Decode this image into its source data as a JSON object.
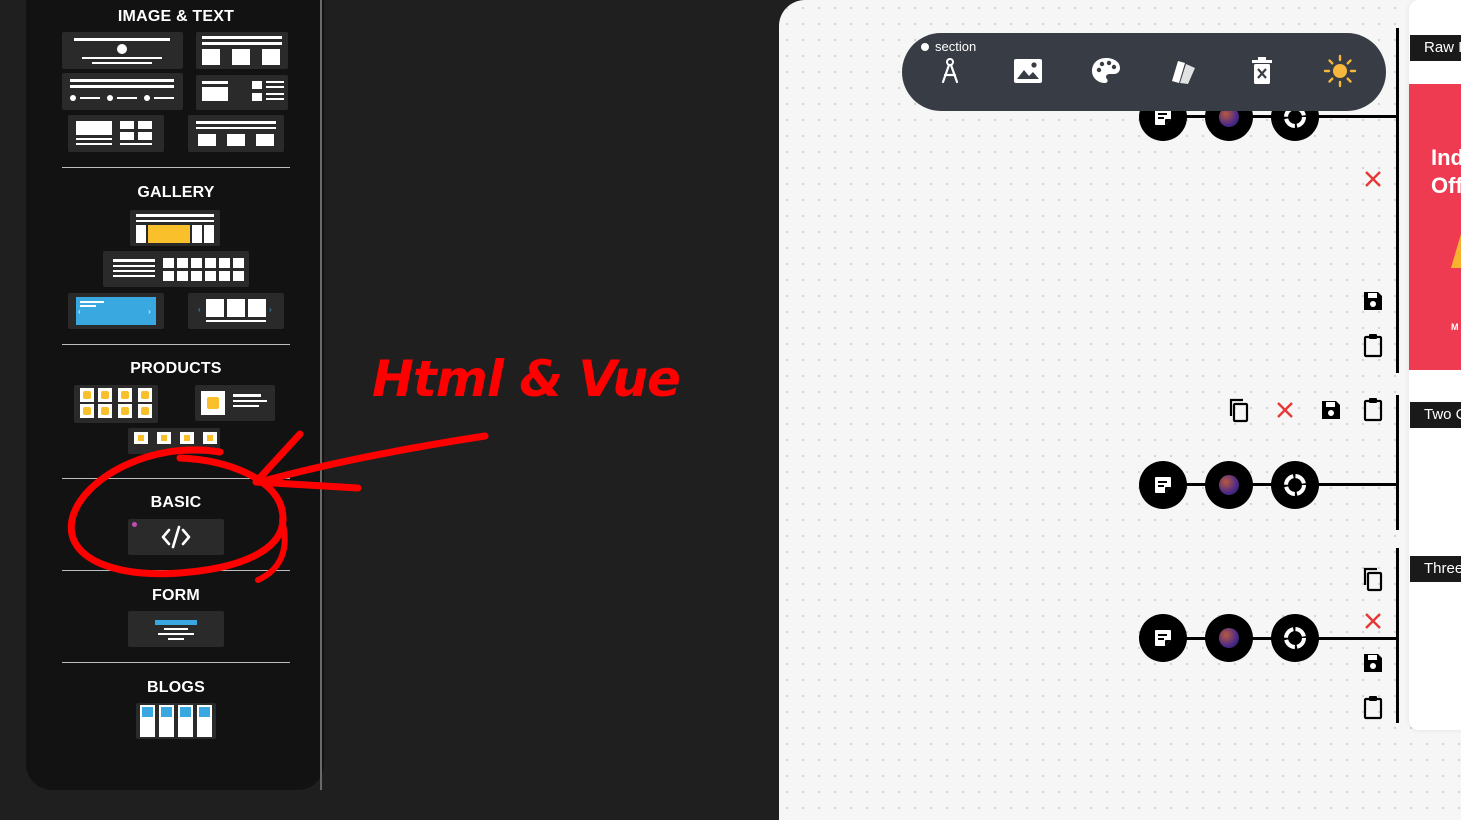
{
  "sidebar": {
    "sections": [
      {
        "title": "IMAGE & TEXT"
      },
      {
        "title": "GALLERY"
      },
      {
        "title": "PRODUCTS"
      },
      {
        "title": "BASIC"
      },
      {
        "title": "FORM"
      },
      {
        "title": "BLOGS"
      }
    ]
  },
  "annotation": {
    "text": "Html & Vue",
    "color": "#ff0000"
  },
  "toolbar": {
    "tag": "section",
    "icons": [
      "compass-icon",
      "image-icon",
      "palette-icon",
      "swatches-icon",
      "delete-icon",
      "sun-icon"
    ]
  },
  "canvas": {
    "blocks": [
      {
        "label": "Raw I"
      },
      {
        "label": "Two C"
      },
      {
        "label": "Three"
      }
    ],
    "preview": {
      "line1": "Ind",
      "line2": "Off",
      "small": "M",
      "bg": "#ef3b51"
    }
  },
  "colors": {
    "accent_yellow": "#f9c02b",
    "accent_blue": "#3aa8e0",
    "close_red": "#e53935"
  }
}
